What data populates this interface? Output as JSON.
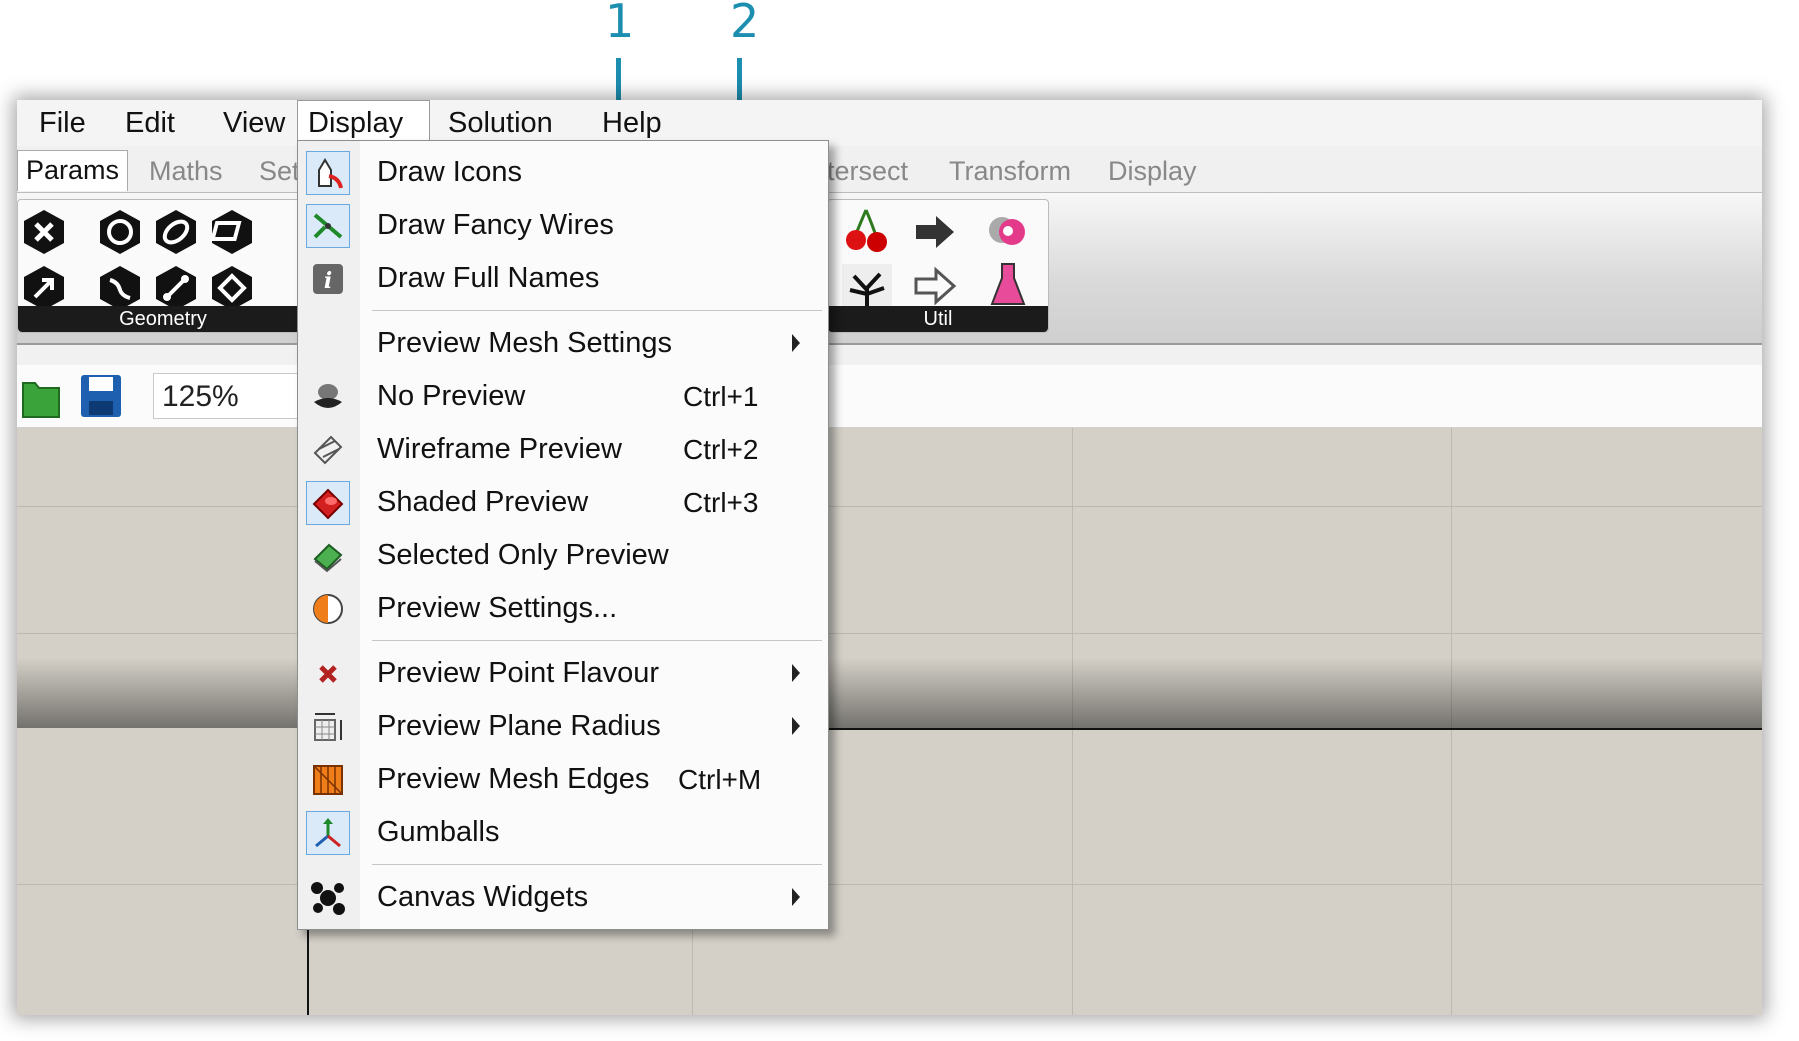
{
  "callouts": [
    "1",
    "2"
  ],
  "menubar": {
    "items": [
      "File",
      "Edit",
      "View",
      "Display",
      "Solution",
      "Help"
    ]
  },
  "tabs": [
    "Params",
    "Maths",
    "Set",
    "tersect",
    "Transform",
    "Display"
  ],
  "ribbon": {
    "geometry_label": "Geometry",
    "util_label": "Util"
  },
  "toolbar": {
    "zoom": "125%"
  },
  "menu": {
    "items": [
      {
        "label": "Draw Icons",
        "icon": "draw-icons-icon",
        "checked": true
      },
      {
        "label": "Draw Fancy Wires",
        "icon": "fancy-wires-icon",
        "checked": true
      },
      {
        "label": "Draw Full Names",
        "icon": "info-icon",
        "checked": false
      },
      {
        "label": "Preview Mesh Settings",
        "submenu": true
      },
      {
        "label": "No Preview",
        "shortcut": "Ctrl+1",
        "icon": "no-preview-icon"
      },
      {
        "label": "Wireframe Preview",
        "shortcut": "Ctrl+2",
        "icon": "wireframe-icon"
      },
      {
        "label": "Shaded Preview",
        "shortcut": "Ctrl+3",
        "icon": "shaded-icon",
        "checked": true
      },
      {
        "label": "Selected Only Preview",
        "icon": "selected-only-icon"
      },
      {
        "label": "Preview Settings...",
        "icon": "preview-settings-icon"
      },
      {
        "label": "Preview Point Flavour",
        "submenu": true,
        "icon": "point-x-icon"
      },
      {
        "label": "Preview Plane Radius",
        "submenu": true,
        "icon": "plane-radius-icon"
      },
      {
        "label": "Preview Mesh Edges",
        "shortcut": "Ctrl+M",
        "icon": "mesh-edges-icon"
      },
      {
        "label": "Gumballs",
        "icon": "gumball-icon",
        "checked": true
      },
      {
        "label": "Canvas Widgets",
        "submenu": true,
        "icon": "widgets-icon"
      }
    ]
  },
  "colors": {
    "callout": "#1c8eb0",
    "canvas": "#d4d0c8",
    "check_bg": "#dbeaf8"
  }
}
